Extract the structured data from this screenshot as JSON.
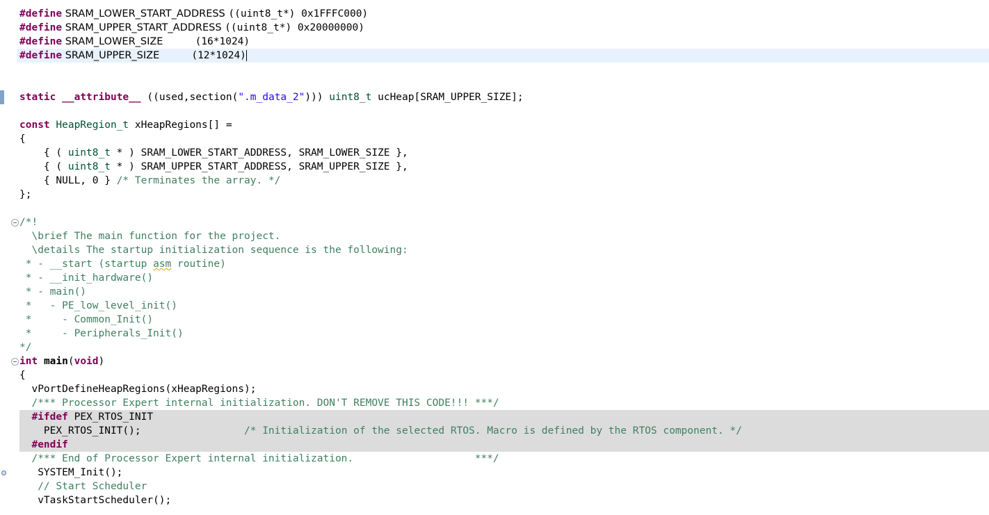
{
  "editor": {
    "lines": [
      {
        "id": "l1",
        "parts": [
          {
            "t": "#define",
            "c": "pp"
          },
          {
            "t": " SRAM_LOWER_START_ADDRESS ",
            "c": "ident"
          },
          {
            "t": "((uint8_t*) 0x1FFFC000)",
            "c": ""
          }
        ]
      },
      {
        "id": "l2",
        "parts": [
          {
            "t": "#define",
            "c": "pp"
          },
          {
            "t": " SRAM_UPPER_START_ADDRESS ",
            "c": "ident"
          },
          {
            "t": "((uint8_t*) 0x20000000)",
            "c": ""
          }
        ]
      },
      {
        "id": "l3",
        "parts": [
          {
            "t": "#define",
            "c": "pp"
          },
          {
            "t": " SRAM_LOWER_SIZE          ",
            "c": "ident"
          },
          {
            "t": "(16*1024)",
            "c": ""
          }
        ]
      },
      {
        "id": "l4",
        "current": true,
        "parts": [
          {
            "t": "#define",
            "c": "pp"
          },
          {
            "t": " SRAM_UPPER_SIZE          ",
            "c": "ident"
          },
          {
            "t": "(12*1024)",
            "c": "",
            "caret": true
          }
        ]
      },
      {
        "id": "l5",
        "parts": []
      },
      {
        "id": "l6",
        "parts": []
      },
      {
        "id": "l7",
        "parts": [
          {
            "t": "static",
            "c": "kw"
          },
          {
            "t": " ",
            "c": ""
          },
          {
            "t": "__attribute__",
            "c": "kw"
          },
          {
            "t": " ((used,section(",
            "c": ""
          },
          {
            "t": "\".m_data_2\"",
            "c": "str"
          },
          {
            "t": "))) ",
            "c": ""
          },
          {
            "t": "uint8_t",
            "c": "ty"
          },
          {
            "t": " ucHeap[SRAM_UPPER_SIZE];",
            "c": ""
          }
        ]
      },
      {
        "id": "l8",
        "parts": []
      },
      {
        "id": "l9",
        "parts": [
          {
            "t": "const",
            "c": "kw"
          },
          {
            "t": " ",
            "c": ""
          },
          {
            "t": "HeapRegion_t",
            "c": "ty"
          },
          {
            "t": " xHeapRegions[] =",
            "c": ""
          }
        ]
      },
      {
        "id": "l10",
        "parts": [
          {
            "t": "{",
            "c": ""
          }
        ]
      },
      {
        "id": "l11",
        "parts": [
          {
            "t": "    { ( ",
            "c": ""
          },
          {
            "t": "uint8_t",
            "c": "ty"
          },
          {
            "t": " * ) SRAM_LOWER_START_ADDRESS, SRAM_LOWER_SIZE },",
            "c": ""
          }
        ]
      },
      {
        "id": "l12",
        "parts": [
          {
            "t": "    { ( ",
            "c": ""
          },
          {
            "t": "uint8_t",
            "c": "ty"
          },
          {
            "t": " * ) SRAM_UPPER_START_ADDRESS, SRAM_UPPER_SIZE },",
            "c": ""
          }
        ]
      },
      {
        "id": "l13",
        "parts": [
          {
            "t": "    { NULL, 0 } ",
            "c": ""
          },
          {
            "t": "/* Terminates the array. */",
            "c": "cm"
          }
        ]
      },
      {
        "id": "l14",
        "parts": [
          {
            "t": "};",
            "c": ""
          }
        ]
      },
      {
        "id": "l15",
        "parts": []
      },
      {
        "id": "l16",
        "parts": [
          {
            "t": "/*!",
            "c": "cm"
          }
        ]
      },
      {
        "id": "l17",
        "parts": [
          {
            "t": "  \\brief The main function for the project.",
            "c": "cm"
          }
        ]
      },
      {
        "id": "l18",
        "parts": [
          {
            "t": "  \\details The startup initialization sequence is the following:",
            "c": "cm"
          }
        ]
      },
      {
        "id": "l19",
        "parts": [
          {
            "t": " * - __start (startup ",
            "c": "cm"
          },
          {
            "t": "asm",
            "c": "cm squiggle"
          },
          {
            "t": " routine)",
            "c": "cm"
          }
        ]
      },
      {
        "id": "l20",
        "parts": [
          {
            "t": " * - __init_hardware()",
            "c": "cm"
          }
        ]
      },
      {
        "id": "l21",
        "parts": [
          {
            "t": " * - main()",
            "c": "cm"
          }
        ]
      },
      {
        "id": "l22",
        "parts": [
          {
            "t": " *   - PE_low_level_init()",
            "c": "cm"
          }
        ]
      },
      {
        "id": "l23",
        "parts": [
          {
            "t": " *     - Common_Init()",
            "c": "cm"
          }
        ]
      },
      {
        "id": "l24",
        "parts": [
          {
            "t": " *     - Peripherals_Init()",
            "c": "cm"
          }
        ]
      },
      {
        "id": "l25",
        "parts": [
          {
            "t": "*/",
            "c": "cm"
          }
        ]
      },
      {
        "id": "l26",
        "parts": [
          {
            "t": "int",
            "c": "kw"
          },
          {
            "t": " ",
            "c": ""
          },
          {
            "t": "main",
            "c": "fn"
          },
          {
            "t": "(",
            "c": ""
          },
          {
            "t": "void",
            "c": "kw"
          },
          {
            "t": ")",
            "c": ""
          }
        ]
      },
      {
        "id": "l27",
        "parts": [
          {
            "t": "{",
            "c": ""
          }
        ]
      },
      {
        "id": "l28",
        "parts": [
          {
            "t": "  vPortDefineHeapRegions(xHeapRegions);",
            "c": ""
          }
        ]
      },
      {
        "id": "l29",
        "parts": [
          {
            "t": "  /*** Processor Expert internal initialization. DON'T REMOVE THIS CODE!!! ***/",
            "c": "cm"
          }
        ]
      },
      {
        "id": "l30",
        "inactive": true,
        "parts": [
          {
            "t": "  ",
            "c": ""
          },
          {
            "t": "#ifdef",
            "c": "pp"
          },
          {
            "t": " PEX_RTOS_INIT",
            "c": ""
          }
        ]
      },
      {
        "id": "l31",
        "inactive": true,
        "parts": [
          {
            "t": "    PEX_RTOS_INIT();                 ",
            "c": ""
          },
          {
            "t": "/* Initialization of the selected RTOS. Macro is defined by the RTOS component. */",
            "c": "cm"
          }
        ]
      },
      {
        "id": "l32",
        "inactive": true,
        "parts": [
          {
            "t": "  ",
            "c": ""
          },
          {
            "t": "#endif",
            "c": "pp"
          }
        ]
      },
      {
        "id": "l33",
        "parts": [
          {
            "t": "  /*** End of Processor Expert internal initialization.                    ***/",
            "c": "cm"
          }
        ]
      },
      {
        "id": "l34",
        "parts": [
          {
            "t": "   SYSTEM_Init();",
            "c": ""
          }
        ]
      },
      {
        "id": "l35",
        "parts": [
          {
            "t": "   // Start Scheduler",
            "c": "cm"
          }
        ]
      },
      {
        "id": "l36",
        "parts": [
          {
            "t": "   vTaskStartScheduler();",
            "c": ""
          }
        ]
      }
    ]
  }
}
